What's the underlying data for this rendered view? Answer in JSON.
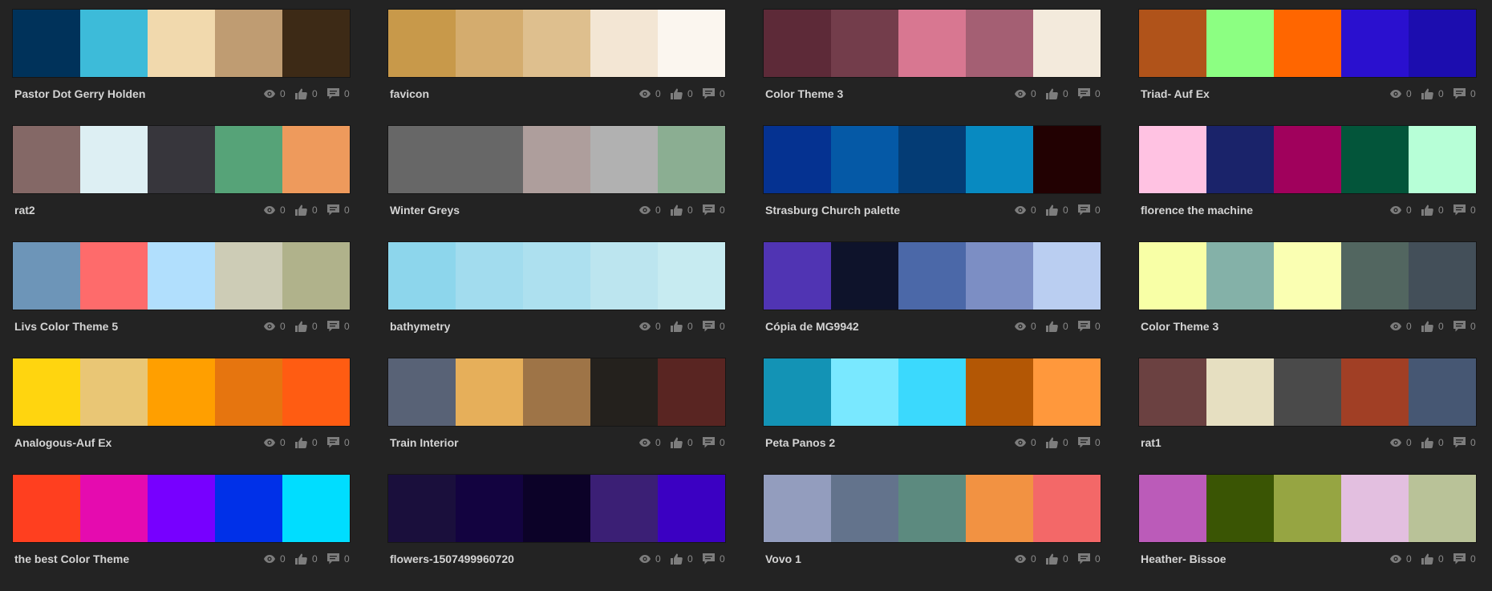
{
  "icons": {
    "views": "eye-icon",
    "likes": "thumbs-up-icon",
    "comments": "comment-icon"
  },
  "icon_color": "#7d7d7d",
  "themes": [
    {
      "name": "Pastor Dot Gerry Holden",
      "colors": [
        "#00325A",
        "#3DBBD9",
        "#F1D9AD",
        "#BF9C72",
        "#3D2A16"
      ],
      "views": "0",
      "likes": "0",
      "comments": "0"
    },
    {
      "name": "favicon",
      "colors": [
        "#C8994A",
        "#D4AC6E",
        "#DEBF8E",
        "#F3E6D4",
        "#FBF6EF"
      ],
      "views": "0",
      "likes": "0",
      "comments": "0"
    },
    {
      "name": "Color Theme 3",
      "colors": [
        "#5D2A38",
        "#733D4B",
        "#D87791",
        "#A45F73",
        "#F3EADC"
      ],
      "views": "0",
      "likes": "0",
      "comments": "0"
    },
    {
      "name": "Triad- Auf Ex",
      "colors": [
        "#B0531A",
        "#8CFF82",
        "#FF6600",
        "#2A10CF",
        "#1C0DAF"
      ],
      "views": "0",
      "likes": "0",
      "comments": "0"
    },
    {
      "name": "rat2",
      "colors": [
        "#846866",
        "#DDEFF3",
        "#37363C",
        "#56A378",
        "#EE9A5C"
      ],
      "views": "0",
      "likes": "0",
      "comments": "0"
    },
    {
      "name": "Winter Greys",
      "colors": [
        "#676767",
        "#676767",
        "#AE9E9C",
        "#B1B1B1",
        "#8BAE92"
      ],
      "views": "0",
      "likes": "0",
      "comments": "0"
    },
    {
      "name": "Strasburg Church palette",
      "colors": [
        "#053291",
        "#0559A6",
        "#043C75",
        "#088AC1",
        "#220102"
      ],
      "views": "0",
      "likes": "0",
      "comments": "0"
    },
    {
      "name": "florence the machine",
      "colors": [
        "#FFC2E2",
        "#1A236A",
        "#A0015C",
        "#03553A",
        "#B7FFD7"
      ],
      "views": "0",
      "likes": "0",
      "comments": "0"
    },
    {
      "name": "Livs Color Theme 5",
      "colors": [
        "#6D95B8",
        "#FE6B6B",
        "#B1DFFD",
        "#CDCCB6",
        "#B0B28B"
      ],
      "views": "0",
      "likes": "0",
      "comments": "0"
    },
    {
      "name": "bathymetry",
      "colors": [
        "#8DD6EC",
        "#A2DCEE",
        "#ADE0EF",
        "#BCE5EF",
        "#C7EBF1"
      ],
      "views": "0",
      "likes": "0",
      "comments": "0"
    },
    {
      "name": "Cópia de MG9942",
      "colors": [
        "#5034B3",
        "#0E132B",
        "#4B68A8",
        "#7C8EC4",
        "#BACEF1"
      ],
      "views": "0",
      "likes": "0",
      "comments": "0"
    },
    {
      "name": "Color Theme 3",
      "colors": [
        "#F8FFA6",
        "#84B1A8",
        "#FAFFB2",
        "#526660",
        "#434F59"
      ],
      "views": "0",
      "likes": "0",
      "comments": "0"
    },
    {
      "name": "Analogous-Auf Ex",
      "colors": [
        "#FFD50F",
        "#E9C675",
        "#FF9F00",
        "#E6750F",
        "#FF5C12"
      ],
      "views": "0",
      "likes": "0",
      "comments": "0"
    },
    {
      "name": "Train Interior",
      "colors": [
        "#586276",
        "#E6AF5A",
        "#9E7447",
        "#24211D",
        "#592522"
      ],
      "views": "0",
      "likes": "0",
      "comments": "0"
    },
    {
      "name": "Peta Panos 2",
      "colors": [
        "#1393B5",
        "#79E8FF",
        "#3BD9FD",
        "#B35705",
        "#FF983C"
      ],
      "views": "0",
      "likes": "0",
      "comments": "0"
    },
    {
      "name": "rat1",
      "colors": [
        "#6B4141",
        "#E6DFC1",
        "#4A4A4A",
        "#A13F25",
        "#465773"
      ],
      "views": "0",
      "likes": "0",
      "comments": "0"
    },
    {
      "name": "the best Color Theme",
      "colors": [
        "#FF3F1F",
        "#E50BAF",
        "#7700FF",
        "#0030E8",
        "#00DDFF"
      ],
      "views": "0",
      "likes": "0",
      "comments": "0"
    },
    {
      "name": "flowers-1507499960720",
      "colors": [
        "#1A0F3C",
        "#130340",
        "#0C0228",
        "#3B1F75",
        "#3B00C2"
      ],
      "views": "0",
      "likes": "0",
      "comments": "0"
    },
    {
      "name": "Vovo 1",
      "colors": [
        "#939DBE",
        "#63738C",
        "#5C8A7F",
        "#F29242",
        "#F36868"
      ],
      "views": "0",
      "likes": "0",
      "comments": "0"
    },
    {
      "name": "Heather- Bissoe",
      "colors": [
        "#BB5BB9",
        "#3A5504",
        "#96A542",
        "#E3BFE0",
        "#B9C298"
      ],
      "views": "0",
      "likes": "0",
      "comments": "0"
    }
  ]
}
